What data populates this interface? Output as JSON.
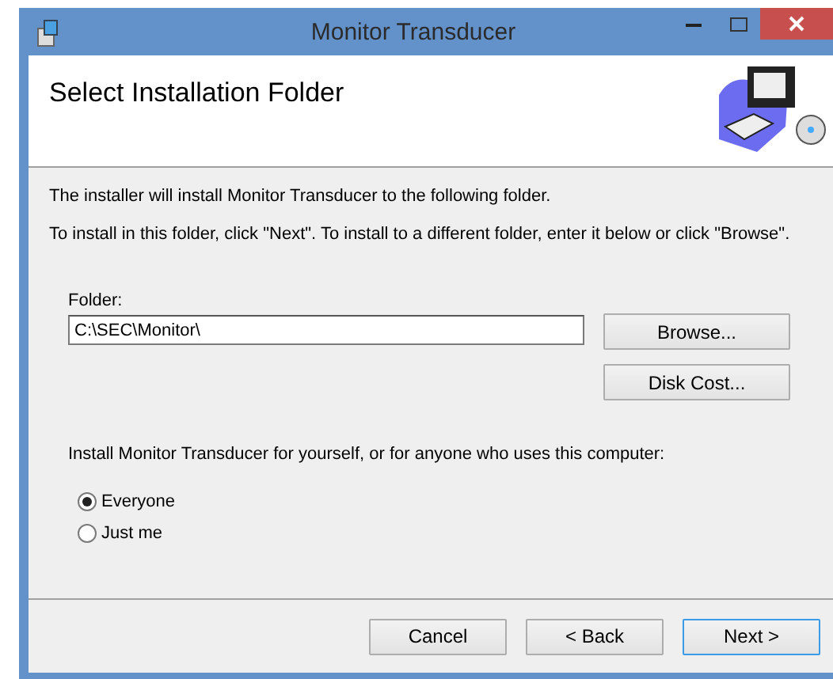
{
  "window": {
    "title": "Monitor Transducer"
  },
  "header": {
    "title": "Select Installation Folder"
  },
  "intro": [
    "The installer will install Monitor Transducer to the following folder.",
    "To install in this folder, click \"Next\". To install to a different folder, enter it below or click \"Browse\"."
  ],
  "folder": {
    "label": "Folder:",
    "value": "C:\\SEC\\Monitor\\"
  },
  "side_buttons": [
    "Browse...",
    "Disk Cost..."
  ],
  "scope": {
    "prompt": "Install Monitor Transducer for yourself, or for anyone who uses this computer:",
    "options": [
      {
        "label": "Everyone",
        "selected": true
      },
      {
        "label": "Just me",
        "selected": false
      }
    ]
  },
  "buttons": [
    {
      "label": "Cancel",
      "default": false
    },
    {
      "label": "< Back",
      "default": false
    },
    {
      "label": "Next >",
      "default": true
    }
  ]
}
